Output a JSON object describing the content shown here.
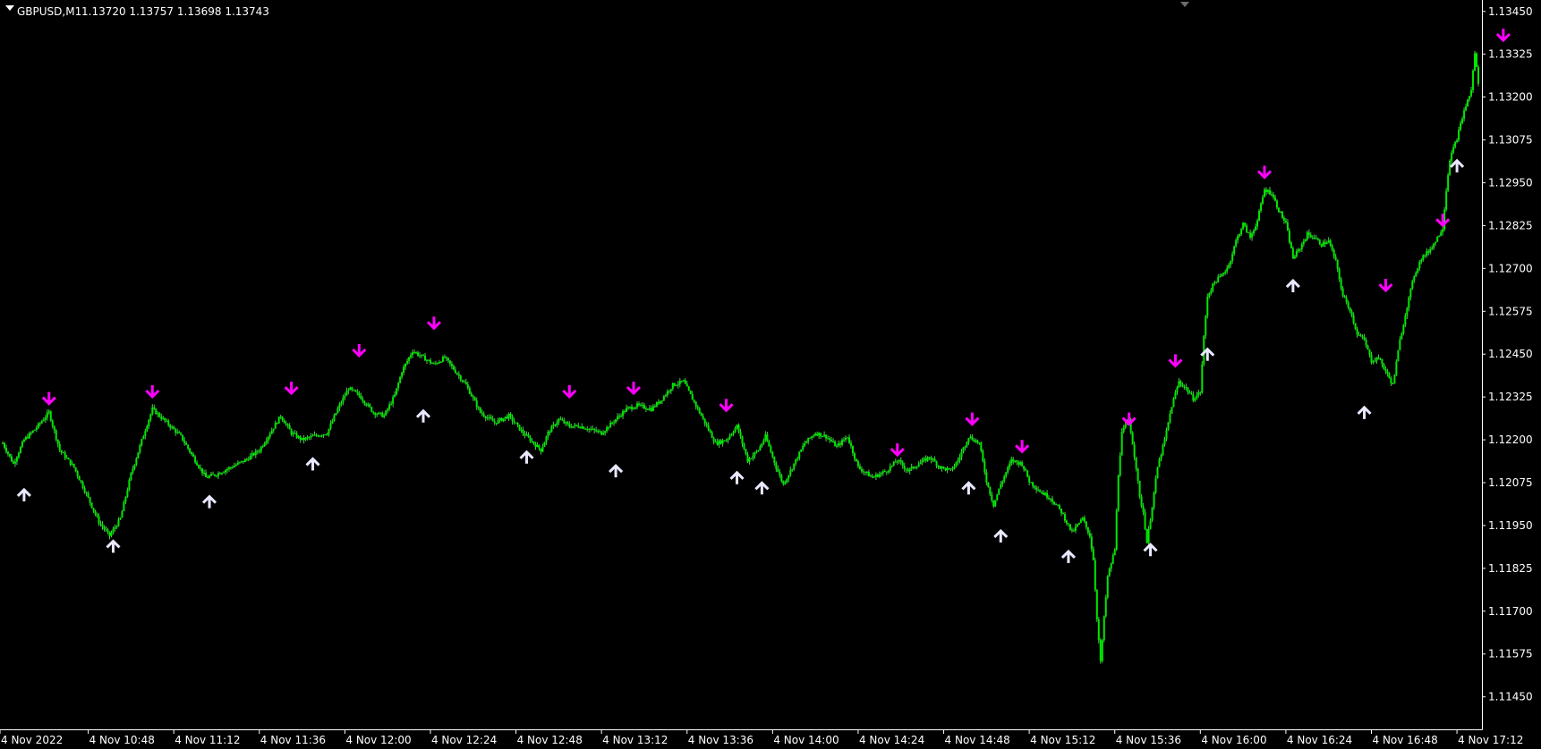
{
  "header": {
    "symbol": "GBPUSD,M1",
    "ohlc": "1.13720 1.13757 1.13698 1.13743"
  },
  "colors": {
    "background": "#000000",
    "candle": "#00e800",
    "candle_wick": "#3fd23f",
    "down_arrow": "#ff00ff",
    "up_arrow": "#e8e8ff",
    "axis": "#ffffff"
  },
  "chart_data": {
    "type": "line",
    "title": "GBPUSD,M1",
    "subtitle": "1.13720 1.13757 1.13698 1.13743",
    "ylim": [
      1.11397,
      1.13465
    ],
    "y_ticks": [
      "1.13450",
      "1.13325",
      "1.13200",
      "1.13075",
      "1.12950",
      "1.12825",
      "1.12700",
      "1.12575",
      "1.12450",
      "1.12325",
      "1.12200",
      "1.12075",
      "1.11950",
      "1.11825",
      "1.11700",
      "1.11575",
      "1.11450"
    ],
    "x_ticks": [
      "4 Nov 2022",
      "4 Nov 10:48",
      "4 Nov 11:12",
      "4 Nov 11:36",
      "4 Nov 12:00",
      "4 Nov 12:24",
      "4 Nov 12:48",
      "4 Nov 13:12",
      "4 Nov 13:36",
      "4 Nov 14:00",
      "4 Nov 14:24",
      "4 Nov 14:48",
      "4 Nov 15:12",
      "4 Nov 15:36",
      "4 Nov 16:00",
      "4 Nov 16:24",
      "4 Nov 16:48",
      "4 Nov 17:12"
    ],
    "x_tick_minutes": [
      0,
      24,
      48,
      72,
      96,
      120,
      144,
      168,
      192,
      216,
      240,
      264,
      288,
      312,
      336,
      360,
      384,
      408
    ],
    "x_range_minutes": [
      0,
      414
    ],
    "series": [
      {
        "points": [
          [
            0,
            1.1219
          ],
          [
            3,
            1.1213
          ],
          [
            6,
            1.122
          ],
          [
            9,
            1.1223
          ],
          [
            13,
            1.1228
          ],
          [
            16,
            1.1217
          ],
          [
            20,
            1.1212
          ],
          [
            24,
            1.1203
          ],
          [
            27,
            1.1196
          ],
          [
            30,
            1.1192
          ],
          [
            33,
            1.1197
          ],
          [
            36,
            1.121
          ],
          [
            40,
            1.1223
          ],
          [
            42,
            1.1229
          ],
          [
            45,
            1.1226
          ],
          [
            50,
            1.1221
          ],
          [
            54,
            1.1214
          ],
          [
            57,
            1.1209
          ],
          [
            60,
            1.121
          ],
          [
            64,
            1.1212
          ],
          [
            68,
            1.1214
          ],
          [
            72,
            1.1217
          ],
          [
            75,
            1.1222
          ],
          [
            78,
            1.1227
          ],
          [
            81,
            1.1222
          ],
          [
            84,
            1.122
          ],
          [
            87,
            1.1221
          ],
          [
            91,
            1.1222
          ],
          [
            94,
            1.1229
          ],
          [
            97,
            1.1235
          ],
          [
            100,
            1.1233
          ],
          [
            104,
            1.1228
          ],
          [
            107,
            1.1227
          ],
          [
            110,
            1.1233
          ],
          [
            112,
            1.124
          ],
          [
            115,
            1.1246
          ],
          [
            118,
            1.1244
          ],
          [
            121,
            1.1242
          ],
          [
            124,
            1.1244
          ],
          [
            127,
            1.124
          ],
          [
            130,
            1.1236
          ],
          [
            134,
            1.1228
          ],
          [
            138,
            1.1225
          ],
          [
            142,
            1.1227
          ],
          [
            146,
            1.1222
          ],
          [
            149,
            1.1219
          ],
          [
            151,
            1.1217
          ],
          [
            153,
            1.1222
          ],
          [
            156,
            1.1226
          ],
          [
            159,
            1.1224
          ],
          [
            162,
            1.1224
          ],
          [
            165,
            1.1223
          ],
          [
            168,
            1.1222
          ],
          [
            172,
            1.1226
          ],
          [
            175,
            1.1229
          ],
          [
            178,
            1.123
          ],
          [
            182,
            1.1229
          ],
          [
            185,
            1.1232
          ],
          [
            188,
            1.1236
          ],
          [
            191,
            1.1237
          ],
          [
            194,
            1.1231
          ],
          [
            197,
            1.1225
          ],
          [
            200,
            1.1219
          ],
          [
            203,
            1.122
          ],
          [
            206,
            1.1224
          ],
          [
            209,
            1.1214
          ],
          [
            212,
            1.1217
          ],
          [
            214,
            1.1221
          ],
          [
            217,
            1.1212
          ],
          [
            219,
            1.1207
          ],
          [
            222,
            1.1213
          ],
          [
            225,
            1.1219
          ],
          [
            228,
            1.1222
          ],
          [
            231,
            1.1221
          ],
          [
            234,
            1.1218
          ],
          [
            237,
            1.1221
          ],
          [
            240,
            1.1212
          ],
          [
            244,
            1.1209
          ],
          [
            248,
            1.1211
          ],
          [
            251,
            1.1214
          ],
          [
            254,
            1.1211
          ],
          [
            257,
            1.1213
          ],
          [
            260,
            1.1215
          ],
          [
            263,
            1.1212
          ],
          [
            266,
            1.1211
          ],
          [
            268,
            1.1214
          ],
          [
            271,
            1.1221
          ],
          [
            274,
            1.1219
          ],
          [
            276,
            1.1208
          ],
          [
            278,
            1.1201
          ],
          [
            280,
            1.1207
          ],
          [
            283,
            1.1214
          ],
          [
            286,
            1.1213
          ],
          [
            288,
            1.1208
          ],
          [
            291,
            1.1205
          ],
          [
            294,
            1.1203
          ],
          [
            297,
            1.1199
          ],
          [
            300,
            1.1193
          ],
          [
            303,
            1.1197
          ],
          [
            305,
            1.1192
          ],
          [
            306,
            1.1185
          ],
          [
            307,
            1.1168
          ],
          [
            308,
            1.1155
          ],
          [
            309,
            1.1168
          ],
          [
            310,
            1.118
          ],
          [
            312,
            1.1188
          ],
          [
            313,
            1.121
          ],
          [
            314,
            1.1222
          ],
          [
            316,
            1.1226
          ],
          [
            318,
            1.1212
          ],
          [
            319,
            1.1203
          ],
          [
            320,
            1.1199
          ],
          [
            321,
            1.119
          ],
          [
            322,
            1.1197
          ],
          [
            324,
            1.1212
          ],
          [
            326,
            1.122
          ],
          [
            328,
            1.123
          ],
          [
            330,
            1.1237
          ],
          [
            332,
            1.1235
          ],
          [
            334,
            1.1232
          ],
          [
            336,
            1.1234
          ],
          [
            337,
            1.125
          ],
          [
            338,
            1.1262
          ],
          [
            340,
            1.1266
          ],
          [
            342,
            1.1268
          ],
          [
            344,
            1.1271
          ],
          [
            346,
            1.1278
          ],
          [
            348,
            1.1283
          ],
          [
            350,
            1.1279
          ],
          [
            352,
            1.1284
          ],
          [
            354,
            1.1293
          ],
          [
            356,
            1.1292
          ],
          [
            358,
            1.1287
          ],
          [
            360,
            1.1283
          ],
          [
            362,
            1.1273
          ],
          [
            364,
            1.1276
          ],
          [
            366,
            1.128
          ],
          [
            368,
            1.1279
          ],
          [
            370,
            1.1277
          ],
          [
            372,
            1.1278
          ],
          [
            374,
            1.1272
          ],
          [
            376,
            1.1262
          ],
          [
            378,
            1.1258
          ],
          [
            380,
            1.1251
          ],
          [
            382,
            1.1249
          ],
          [
            384,
            1.1243
          ],
          [
            386,
            1.1244
          ],
          [
            388,
            1.124
          ],
          [
            390,
            1.1236
          ],
          [
            392,
            1.1249
          ],
          [
            394,
            1.1259
          ],
          [
            396,
            1.1268
          ],
          [
            398,
            1.1273
          ],
          [
            400,
            1.1275
          ],
          [
            402,
            1.1278
          ],
          [
            404,
            1.1282
          ],
          [
            405,
            1.1293
          ],
          [
            406,
            1.1302
          ],
          [
            408,
            1.1308
          ],
          [
            410,
            1.1316
          ],
          [
            412,
            1.1322
          ],
          [
            413,
            1.1333
          ],
          [
            414,
            1.1324
          ]
        ]
      }
    ],
    "annotations": {
      "down_arrows": [
        [
          13,
          1.1229
        ],
        [
          42,
          1.1231
        ],
        [
          81,
          1.1232
        ],
        [
          100,
          1.1243
        ],
        [
          121,
          1.1251
        ],
        [
          159,
          1.1231
        ],
        [
          177,
          1.1232
        ],
        [
          203,
          1.1227
        ],
        [
          251,
          1.1214
        ],
        [
          272,
          1.1223
        ],
        [
          286,
          1.1215
        ],
        [
          316,
          1.1223
        ],
        [
          329,
          1.124
        ],
        [
          354,
          1.1295
        ],
        [
          388,
          1.1262
        ],
        [
          404,
          1.1281
        ],
        [
          421,
          1.1335
        ]
      ],
      "up_arrows": [
        [
          6,
          1.1207
        ],
        [
          31,
          1.1192
        ],
        [
          58,
          1.1205
        ],
        [
          87,
          1.1216
        ],
        [
          118,
          1.123
        ],
        [
          147,
          1.1218
        ],
        [
          172,
          1.1214
        ],
        [
          206,
          1.1212
        ],
        [
          213,
          1.1209
        ],
        [
          271,
          1.1209
        ],
        [
          280,
          1.1195
        ],
        [
          299,
          1.1189
        ],
        [
          322,
          1.1191
        ],
        [
          338,
          1.1248
        ],
        [
          362,
          1.1268
        ],
        [
          382,
          1.1231
        ],
        [
          408,
          1.1303
        ]
      ]
    }
  }
}
